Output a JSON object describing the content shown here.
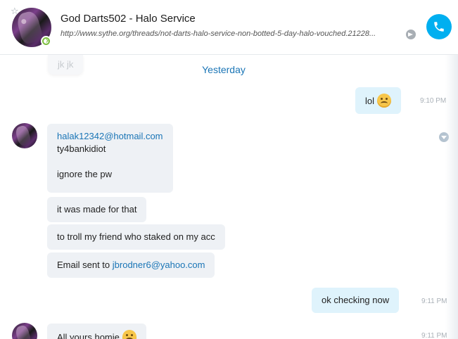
{
  "header": {
    "title": "God Darts502 - Halo Service",
    "subtitle": "http://www.sythe.org/threads/not-darts-halo-service-non-botted-5-day-halo-vouched.21228..."
  },
  "chat": {
    "faded_message": "jk jk",
    "divider": "Yesterday",
    "messages": [
      {
        "text": "lol",
        "time": "9:10 PM"
      },
      {
        "email": "halak12342@hotmail.com",
        "line2": "ty4bankidiot",
        "line3": "ignore the pw"
      },
      {
        "text": "it was made for that"
      },
      {
        "text": "to troll my friend who staked on my acc"
      },
      {
        "prefix": "Email sent to ",
        "email": "jbrodner6@yahoo.com"
      },
      {
        "text": "ok checking now",
        "time": "9:11 PM"
      },
      {
        "text": "All yours homie",
        "time": "9:11 PM"
      }
    ]
  },
  "colors": {
    "accent": "#00aff0",
    "link": "#1a75b6",
    "incoming": "#eef1f5",
    "outgoing": "#dff3fc"
  },
  "icons": [
    "star-icon",
    "online-status-icon",
    "open-link-icon",
    "phone-icon",
    "message-menu-icon",
    "smile-emoji-icon"
  ]
}
